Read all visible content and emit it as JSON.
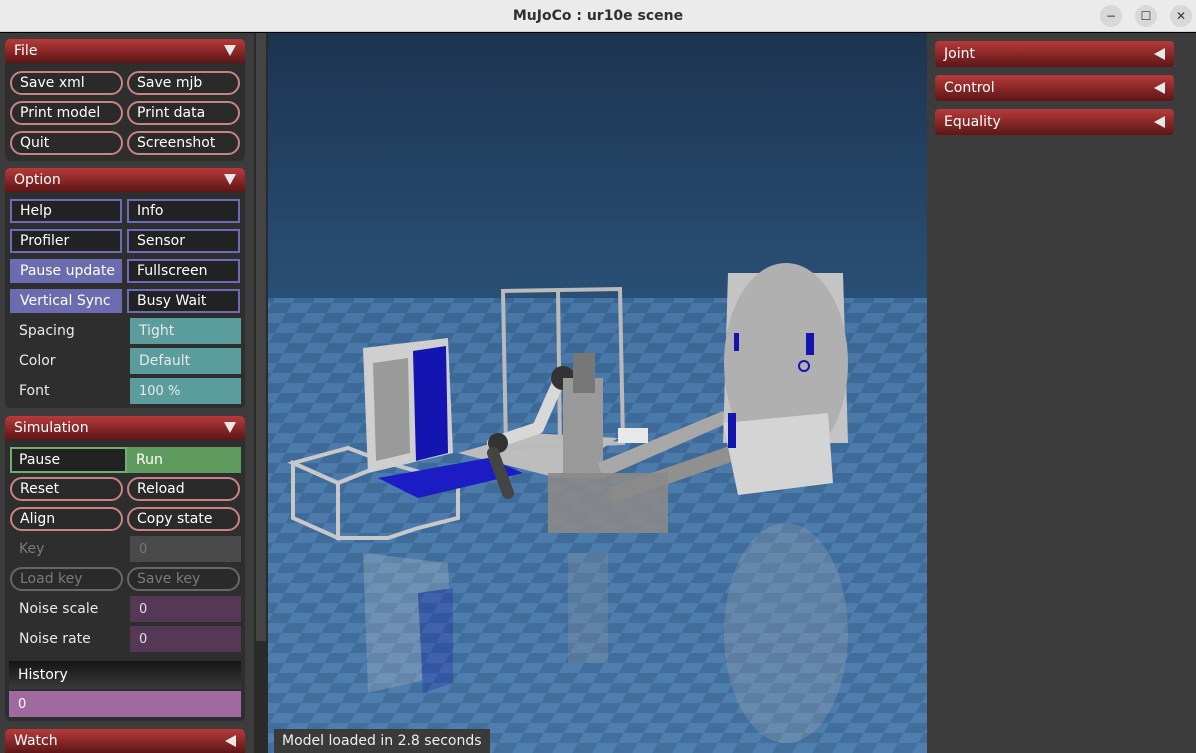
{
  "window": {
    "title": "MuJoCo : ur10e scene",
    "minimize_icon": "−",
    "maximize_icon": "☐",
    "close_icon": "✕"
  },
  "file": {
    "header": "File",
    "save_xml": "Save xml",
    "save_mjb": "Save mjb",
    "print_model": "Print model",
    "print_data": "Print data",
    "quit": "Quit",
    "screenshot": "Screenshot"
  },
  "option": {
    "header": "Option",
    "help": "Help",
    "info": "Info",
    "profiler": "Profiler",
    "sensor": "Sensor",
    "pause_update": "Pause update",
    "fullscreen": "Fullscreen",
    "vertical_sync": "Vertical Sync",
    "busy_wait": "Busy Wait",
    "spacing_label": "Spacing",
    "spacing_value": "Tight",
    "color_label": "Color",
    "color_value": "Default",
    "font_label": "Font",
    "font_value": "100 %"
  },
  "simulation": {
    "header": "Simulation",
    "pause": "Pause",
    "run": "Run",
    "reset": "Reset",
    "reload": "Reload",
    "align": "Align",
    "copy_state": "Copy state",
    "key_label": "Key",
    "key_value": "0",
    "load_key": "Load key",
    "save_key": "Save key",
    "noise_scale_label": "Noise scale",
    "noise_scale_value": "0",
    "noise_rate_label": "Noise rate",
    "noise_rate_value": "0",
    "history_label": "History",
    "history_value": "0"
  },
  "watch": {
    "header": "Watch"
  },
  "right": {
    "joint": "Joint",
    "control": "Control",
    "equality": "Equality"
  },
  "viewport": {
    "status": "Model loaded in 2.8 seconds"
  },
  "colors": {
    "header_red": "#b83a3a",
    "check_blue": "#6b6bb0",
    "teal": "#5b9c9c",
    "run_green": "#5f9a5f",
    "purple_field": "#553855",
    "history_pink": "#a06aa0"
  }
}
